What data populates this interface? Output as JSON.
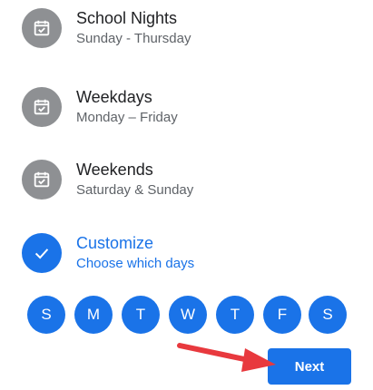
{
  "options": [
    {
      "title": "School Nights",
      "subtitle": "Sunday - Thursday",
      "icon": "calendar-check-icon",
      "selected": false
    },
    {
      "title": "Weekdays",
      "subtitle": "Monday – Friday",
      "icon": "calendar-check-icon",
      "selected": false
    },
    {
      "title": "Weekends",
      "subtitle": "Saturday & Sunday",
      "icon": "calendar-check-icon",
      "selected": false
    },
    {
      "title": "Customize",
      "subtitle": "Choose which days",
      "icon": "checkmark-icon",
      "selected": true
    }
  ],
  "days": [
    "S",
    "M",
    "T",
    "W",
    "T",
    "F",
    "S"
  ],
  "next_label": "Next",
  "colors": {
    "accent": "#1a73e8",
    "icon_gray": "#8e9093",
    "title_text": "#202124",
    "subtitle_text": "#5f6368",
    "annotation_arrow": "#e8393e"
  }
}
